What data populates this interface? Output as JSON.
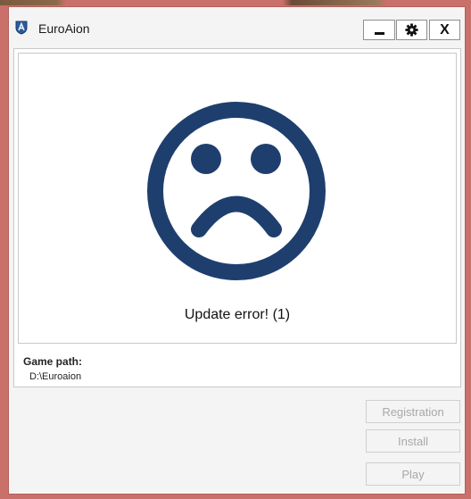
{
  "window": {
    "title": "EuroAion",
    "app_icon": "aion-shield-icon",
    "controls": {
      "minimize_icon": "minimize-icon",
      "settings_icon": "gear-icon",
      "close_label": "X"
    }
  },
  "status": {
    "icon": "sad-face-icon",
    "message": "Update error! (1)"
  },
  "game_path": {
    "label": "Game path:",
    "value": "D:\\Euroaion"
  },
  "buttons": {
    "registration": "Registration",
    "install": "Install",
    "play": "Play"
  },
  "colors": {
    "accent": "#1e3f6e",
    "window_border": "#c9706a",
    "disabled_text": "#a8a8a8"
  }
}
